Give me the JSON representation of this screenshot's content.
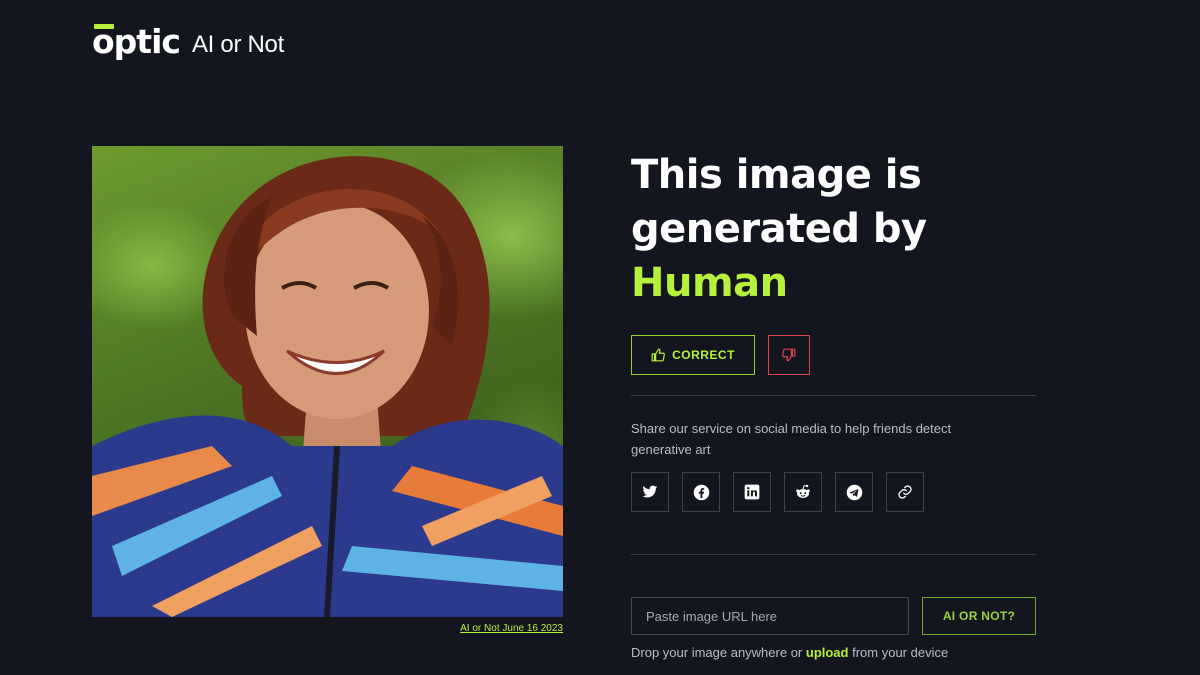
{
  "header": {
    "logo_text": "optic",
    "product_name": "AI or Not"
  },
  "photo": {
    "caption": "AI or Not June 16 2023"
  },
  "result": {
    "headline_prefix": "This image is generated by",
    "verdict": "Human",
    "correct_label": "CORRECT",
    "incorrect_icon": "thumbs-down-icon",
    "correct_icon": "thumbs-up-icon"
  },
  "share": {
    "text": "Share our service on social media to help friends detect generative art",
    "networks": [
      "twitter-icon",
      "facebook-icon",
      "linkedin-icon",
      "reddit-icon",
      "telegram-icon",
      "link-icon"
    ]
  },
  "upload": {
    "url_placeholder": "Paste image URL here",
    "submit_label": "AI OR NOT?",
    "hint_prefix": "Drop your image anywhere or",
    "hint_link": "upload",
    "hint_suffix": "from your device"
  },
  "colors": {
    "background": "#13161f",
    "accent_green": "#b6f23b",
    "negative_red": "#d9434f"
  }
}
